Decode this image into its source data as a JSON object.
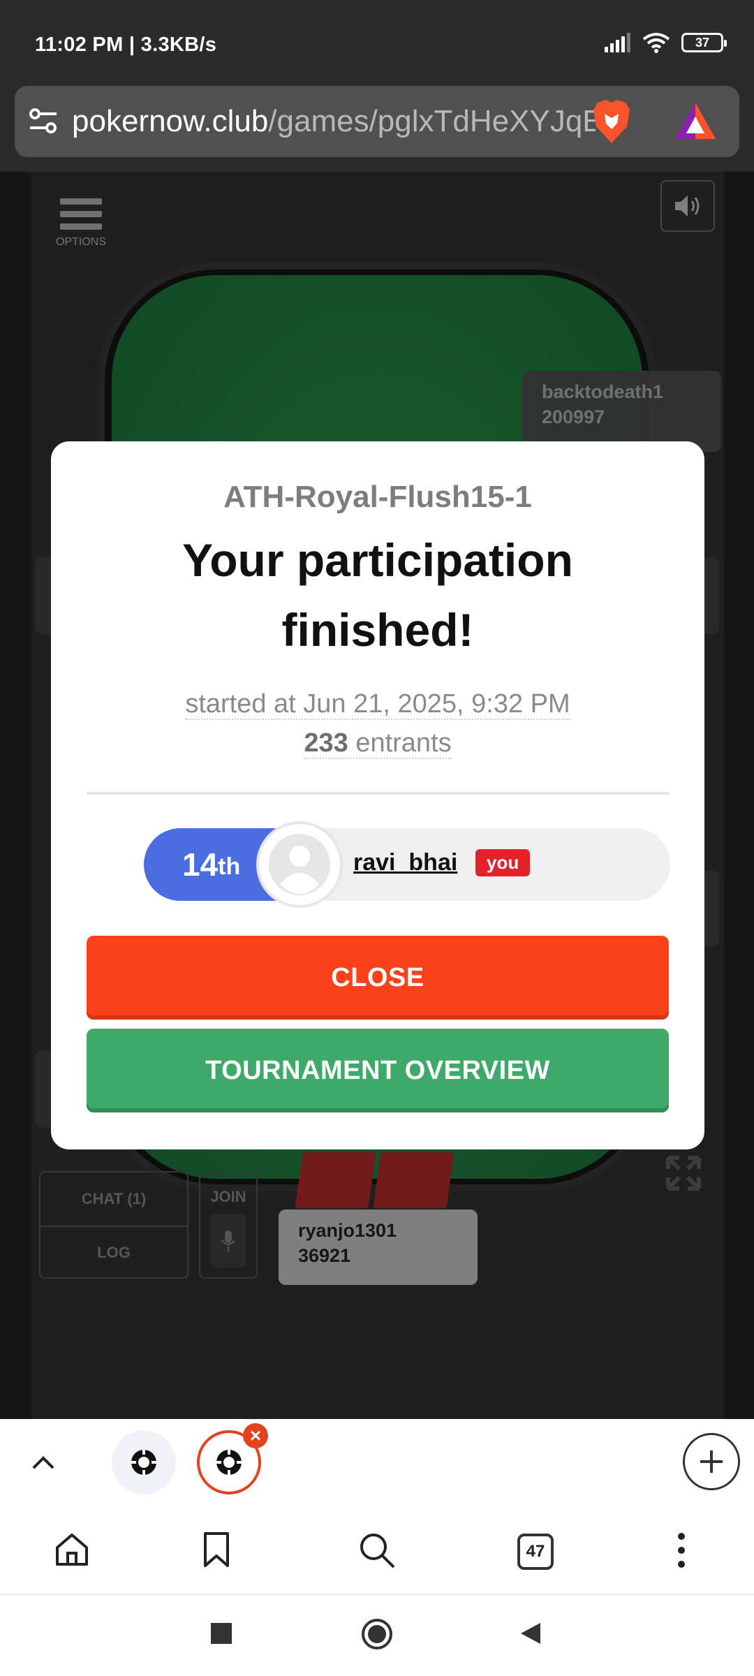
{
  "status": {
    "time": "11:02 PM | 3.3KB/s",
    "battery": "37"
  },
  "browser": {
    "url_host": "pokernow.club",
    "url_path": "/games/pglxTdHeXYJqEa",
    "tab_count": "47"
  },
  "game": {
    "options_label": "OPTIONS",
    "seat_top": {
      "name": "backtodeath1",
      "stack": "200997"
    },
    "seat_bottom": {
      "name": "ryanjo1301",
      "stack": "36921"
    },
    "chat_label": "CHAT (1)",
    "log_label": "LOG",
    "join_label": "JOIN"
  },
  "modal": {
    "tournament_name": "ATH-Royal-Flush15-1",
    "headline": "Your participation finished!",
    "started_prefix": "started at ",
    "started_at": "Jun 21, 2025, 9:32 PM",
    "entrants_count": "233",
    "entrants_label": " entrants",
    "rank_number": "14",
    "rank_suffix": "th",
    "username": "ravi_bhai",
    "you_badge": "you",
    "close_label": "CLOSE",
    "overview_label": "TOURNAMENT OVERVIEW"
  },
  "colors": {
    "close": "#fb4119",
    "overview": "#3fa96a",
    "rank": "#4a6ee0",
    "you_badge": "#e4222a",
    "felt": "#1a6533"
  }
}
